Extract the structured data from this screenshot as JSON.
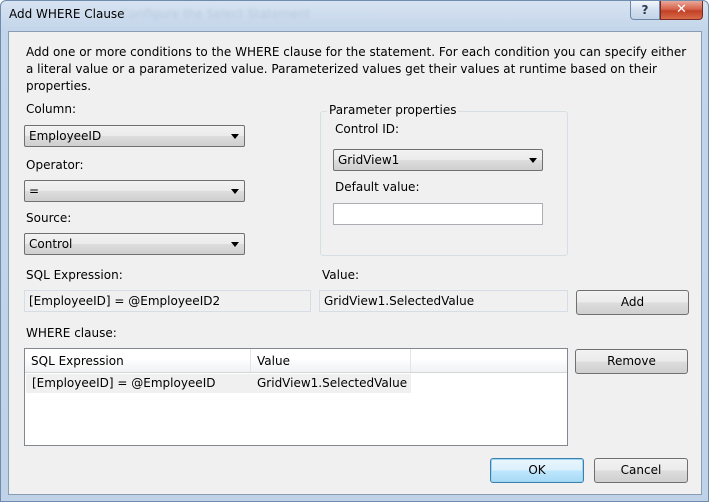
{
  "window": {
    "title": "Add WHERE Clause",
    "ghost_title": "Configure the Select Statement",
    "help_glyph": "?",
    "close_glyph": "✕"
  },
  "description": "Add one or more conditions to the WHERE clause for the statement. For each condition you can specify either a literal value or a parameterized value. Parameterized values get their values at runtime based on their properties.",
  "column": {
    "label": "Column:",
    "value": "EmployeeID"
  },
  "operator": {
    "label": "Operator:",
    "value": "="
  },
  "source": {
    "label": "Source:",
    "value": "Control"
  },
  "parameter_properties": {
    "legend": "Parameter properties",
    "control_id_label": "Control ID:",
    "control_id_value": "GridView1",
    "default_value_label": "Default value:",
    "default_value": ""
  },
  "sql_expression": {
    "label": "SQL Expression:",
    "value": "[EmployeeID] = @EmployeeID2"
  },
  "value": {
    "label": "Value:",
    "value": "GridView1.SelectedValue"
  },
  "where_clause": {
    "label": "WHERE clause:",
    "columns": [
      "SQL Expression",
      "Value"
    ],
    "rows": [
      {
        "sql_expression": "[EmployeeID] = @EmployeeID",
        "value": "GridView1.SelectedValue"
      }
    ]
  },
  "buttons": {
    "add": "Add",
    "remove": "Remove",
    "ok": "OK",
    "cancel": "Cancel"
  }
}
